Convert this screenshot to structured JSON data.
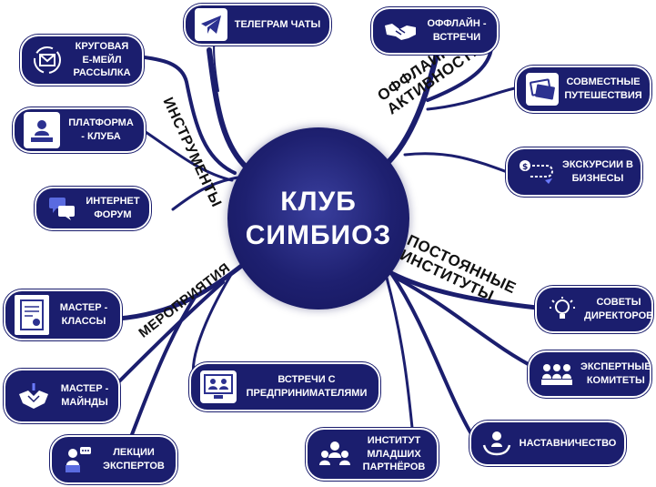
{
  "center": {
    "line1": "КЛУБ",
    "line2": "СИМБИОЗ"
  },
  "categories": {
    "tools": "ИНСТРУМЕНТЫ",
    "offline_l1": "ОФФЛАЙН",
    "offline_l2": "АКТИВНОСТИ",
    "permanent_l1": "ПОСТОЯННЫЕ",
    "permanent_l2": "ИНСТИТУТЫ",
    "events": "МЕРОПРИЯТИЯ"
  },
  "nodes": {
    "telegram": "ТЕЛЕГРАМ ЧАТЫ",
    "email": "КРУГОВАЯ Е-МЕЙЛ РАССЫЛКА",
    "platform": "ПЛАТФОРМА - КЛУБА",
    "forum": "ИНТЕРНЕТ ФОРУМ",
    "offline_meetings": "ОФФЛАЙН - ВСТРЕЧИ",
    "travel": "СОВМЕСТНЫЕ ПУТЕШЕСТВИЯ",
    "excursions": "ЭКСКУРСИИ В БИЗНЕСЫ",
    "councils": "СОВЕТЫ ДИРЕКТОРОВ",
    "committees": "ЭКСПЕРТНЫЕ КОМИТЕТЫ",
    "mentoring": "НАСТАВНИЧЕСТВО",
    "junior": "ИНСТИТУТ МЛАДШИХ ПАРТНЁРОВ",
    "entrepreneurs": "ВСТРЕЧИ С ПРЕДПРИНИМАТЕЛЯМИ",
    "lectures": "ЛЕКЦИИ ЭКСПЕРТОВ",
    "mastermind": "МАСТЕР - МАЙНДЫ",
    "masterclass": "МАСТЕР - КЛАССЫ"
  },
  "icons": {
    "telegram": "telegram-icon",
    "email": "email-cycle-icon",
    "platform": "profile-card-icon",
    "forum": "chat-bubbles-icon",
    "offline_meetings": "handshake-icon",
    "travel": "tickets-icon",
    "excursions": "route-icon",
    "councils": "lightbulb-icon",
    "committees": "group-icon",
    "mentoring": "hands-person-icon",
    "junior": "team-icon",
    "entrepreneurs": "video-meeting-icon",
    "lectures": "speaker-icon",
    "mastermind": "hands-together-icon",
    "masterclass": "certificate-icon"
  },
  "colors": {
    "node_bg": "#1b1e6e",
    "hub": "#1e2070",
    "text": "#ffffff"
  }
}
